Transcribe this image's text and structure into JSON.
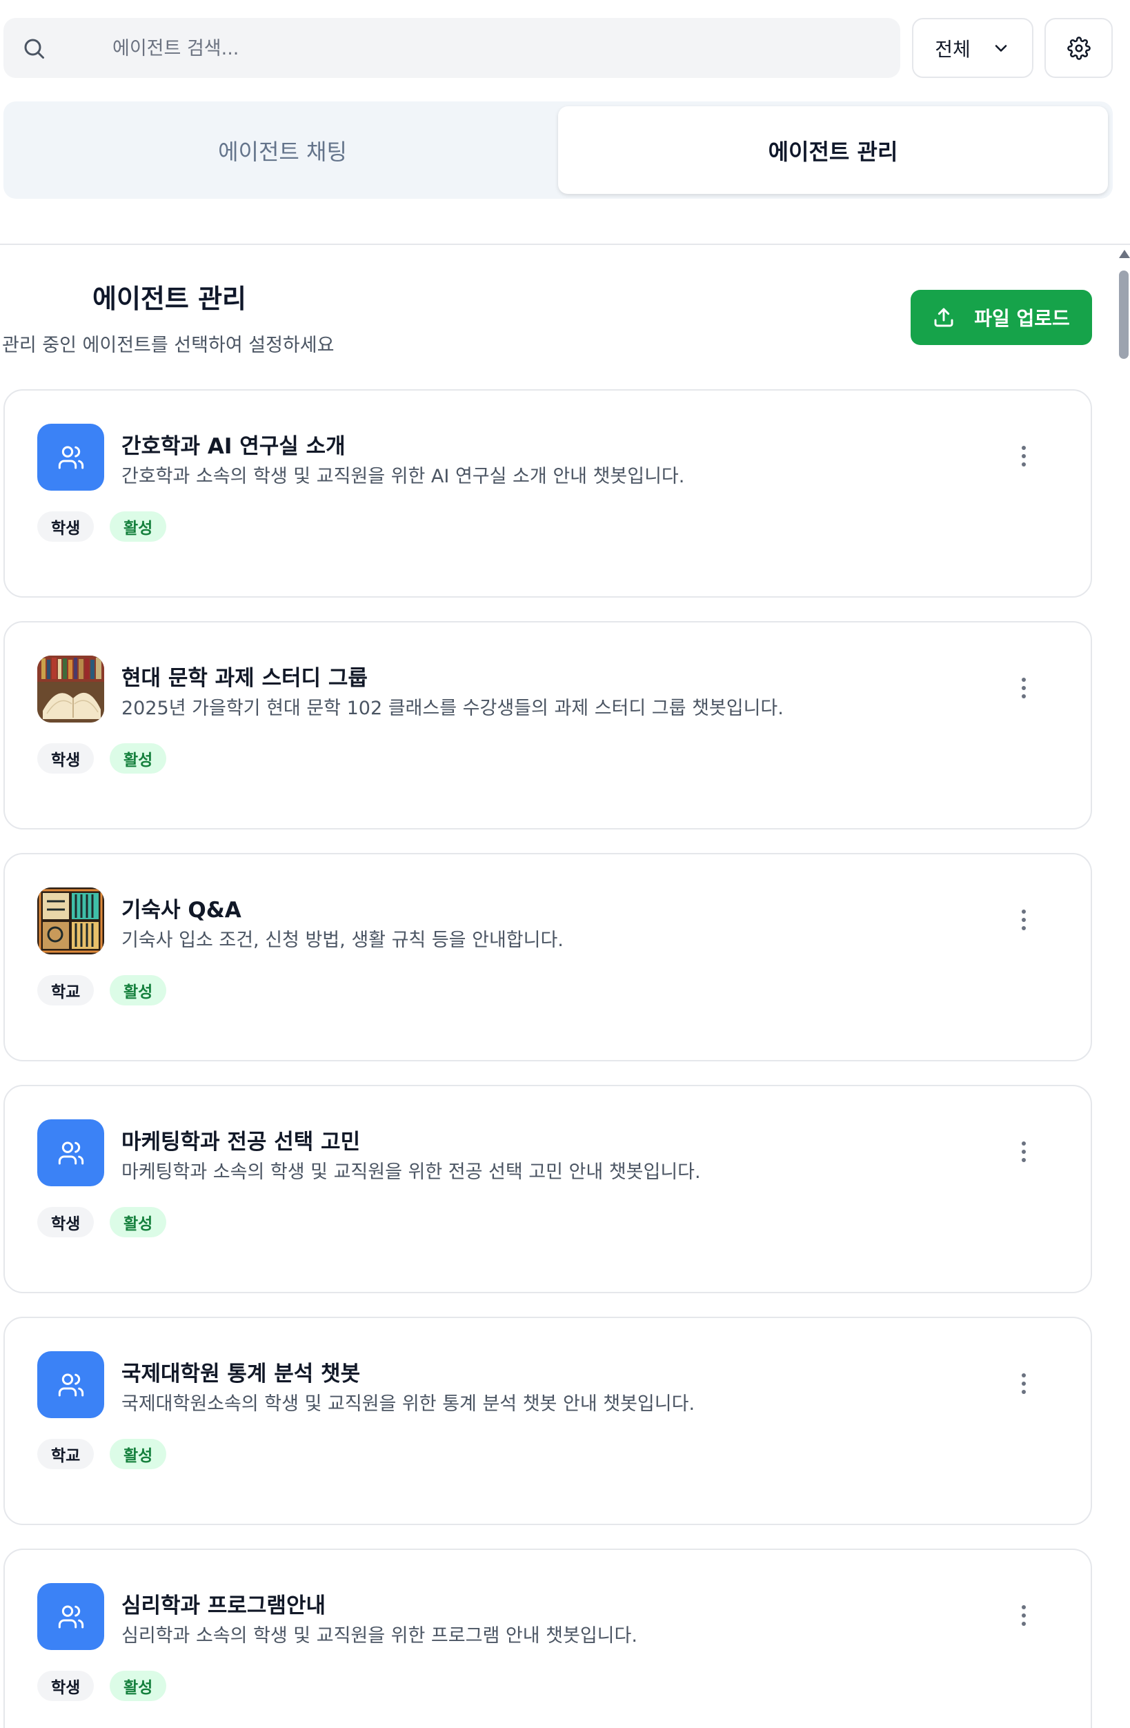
{
  "search": {
    "placeholder": "에이전트 검색..."
  },
  "filter": {
    "selected": "전체"
  },
  "tabs": [
    {
      "label": "에이전트 채팅",
      "active": false
    },
    {
      "label": "에이전트 관리",
      "active": true
    }
  ],
  "section": {
    "title": "에이전트 관리",
    "subtitle": "관리 중인 에이전트를 선택하여 설정하세요",
    "upload_label": "파일 업로드"
  },
  "colors": {
    "accent_blue": "#3b82f6",
    "upload_green": "#16a34a",
    "active_badge_bg": "#dcfce7",
    "active_badge_text": "#15803d"
  },
  "agents": [
    {
      "title": "간호학과 AI 연구실 소개",
      "description": "간호학과 소속의 학생 및 교직원을 위한 AI 연구실 소개 안내 챗봇입니다.",
      "role": "학생",
      "status": "활성",
      "avatar": "users-icon"
    },
    {
      "title": "현대 문학 과제 스터디 그룹",
      "description": "2025년 가을학기 현대 문학 102 클래스를 수강생들의 과제 스터디 그룹 챗봇입니다.",
      "role": "학생",
      "status": "활성",
      "avatar": "book-image"
    },
    {
      "title": "기숙사 Q&A",
      "description": "기숙사 입소 조건, 신청 방법, 생활 규칙 등을 안내합니다.",
      "role": "학교",
      "status": "활성",
      "avatar": "bookshelf-image"
    },
    {
      "title": "마케팅학과 전공 선택 고민",
      "description": "마케팅학과 소속의 학생 및 교직원을 위한 전공 선택 고민 안내 챗봇입니다.",
      "role": "학생",
      "status": "활성",
      "avatar": "users-icon"
    },
    {
      "title": "국제대학원 통계 분석 챗봇",
      "description": "국제대학원소속의 학생 및 교직원을 위한 통계 분석 챗봇 안내 챗봇입니다.",
      "role": "학교",
      "status": "활성",
      "avatar": "users-icon"
    },
    {
      "title": "심리학과 프로그램안내",
      "description": "심리학과 소속의 학생 및 교직원을 위한 프로그램 안내 챗봇입니다.",
      "role": "학생",
      "status": "활성",
      "avatar": "users-icon"
    }
  ]
}
